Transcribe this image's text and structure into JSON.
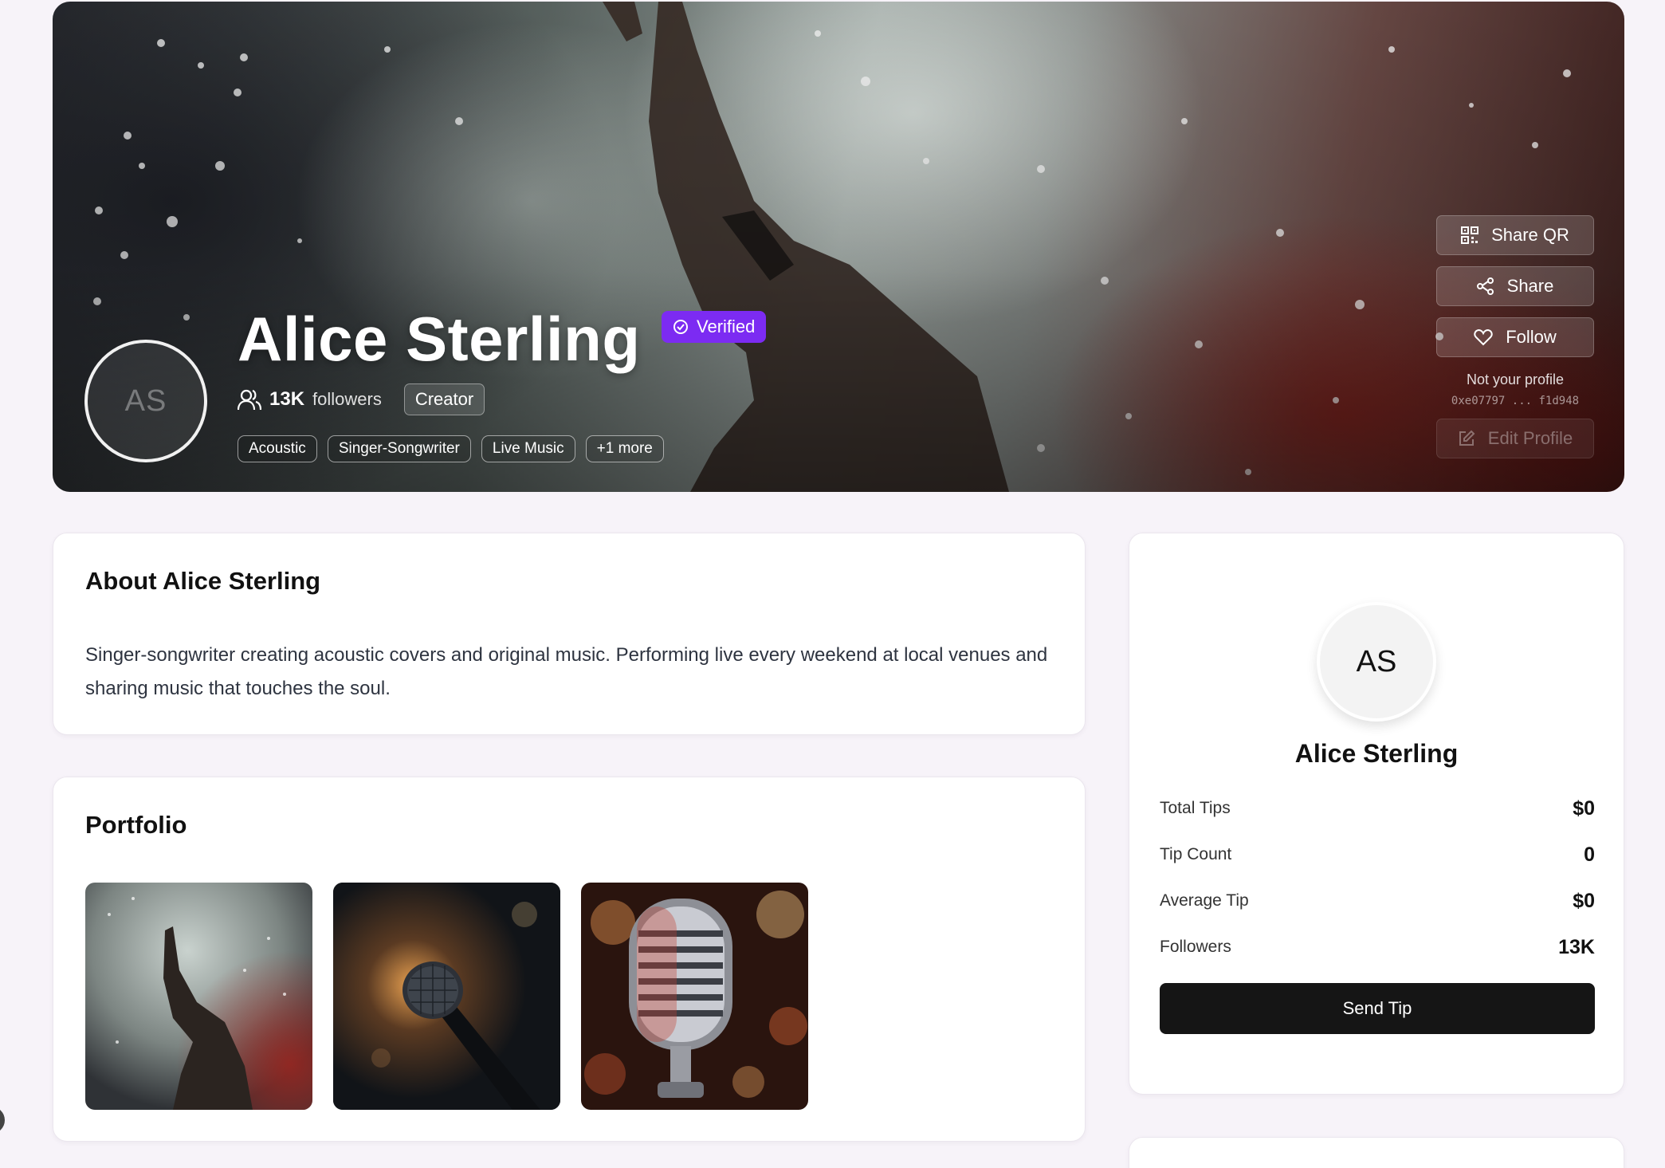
{
  "hero": {
    "avatar_initials": "AS",
    "name": "Alice Sterling",
    "verified_label": "Verified",
    "followers_count": "13K",
    "followers_label": "followers",
    "role": "Creator",
    "tags": [
      "Acoustic",
      "Singer-Songwriter",
      "Live Music",
      "+1 more"
    ],
    "actions": {
      "share_qr": "Share QR",
      "share": "Share",
      "follow": "Follow",
      "not_your_profile": "Not your profile",
      "wallet": "0xe07797 ... f1d948",
      "edit_profile": "Edit Profile"
    }
  },
  "about": {
    "title": "About Alice Sterling",
    "text": "Singer-songwriter creating acoustic covers and original music. Performing live every weekend at local venues and sharing music that touches the soul."
  },
  "portfolio": {
    "title": "Portfolio"
  },
  "sidebar": {
    "avatar_initials": "AS",
    "name": "Alice Sterling",
    "stats": [
      {
        "label": "Total Tips",
        "value": "$0"
      },
      {
        "label": "Tip Count",
        "value": "0"
      },
      {
        "label": "Average Tip",
        "value": "$0"
      },
      {
        "label": "Followers",
        "value": "13K"
      }
    ],
    "send_tip": "Send Tip"
  },
  "colors": {
    "accent": "#7c2bf2",
    "primary_button": "#151515",
    "page_bg": "#f7f3f9"
  }
}
